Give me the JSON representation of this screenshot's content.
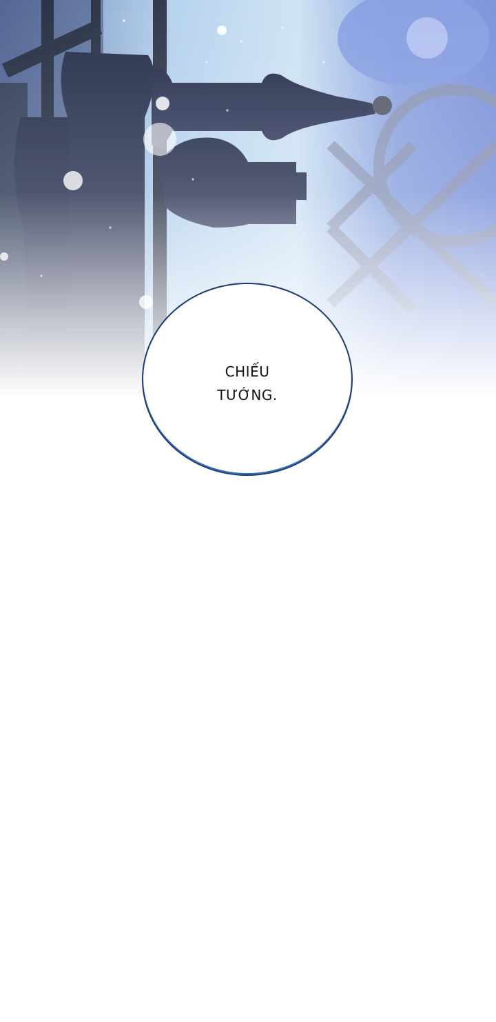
{
  "panel": {
    "bubble_line_1": "CHIẾU",
    "bubble_line_2": "TƯỚNG."
  },
  "colors": {
    "sky_blue": "#a9c9ea",
    "lavender": "#aeb2de",
    "chess_piece_navy": "#2a3148",
    "bubble_outline": "#1e3a74",
    "fade_white": "#ffffff"
  }
}
